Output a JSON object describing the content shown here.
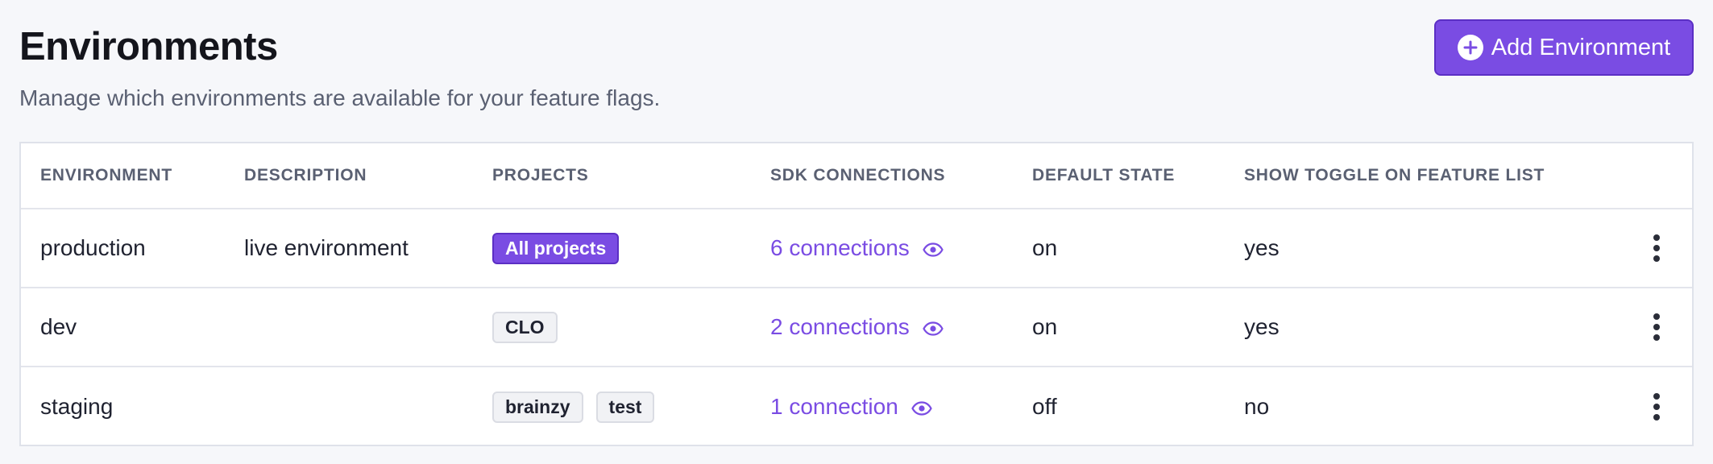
{
  "header": {
    "title": "Environments",
    "subtitle": "Manage which environments are available for your feature flags.",
    "add_button_label": "Add Environment",
    "add_button_icon": "plus-circle-icon"
  },
  "colors": {
    "accent": "#7a4ce3",
    "accent_border": "#5b2fc4",
    "text": "#1f2230",
    "muted": "#5a6072",
    "background": "#f6f7fa"
  },
  "table": {
    "columns": [
      "ENVIRONMENT",
      "DESCRIPTION",
      "PROJECTS",
      "SDK CONNECTIONS",
      "DEFAULT STATE",
      "SHOW TOGGLE ON FEATURE LIST"
    ],
    "rows": [
      {
        "environment": "production",
        "description": "live environment",
        "projects": [
          "All projects"
        ],
        "sdk_connections": "6 connections",
        "default_state": "on",
        "show_toggle": "yes"
      },
      {
        "environment": "dev",
        "description": "",
        "projects": [
          "CLO"
        ],
        "sdk_connections": "2 connections",
        "default_state": "on",
        "show_toggle": "yes"
      },
      {
        "environment": "staging",
        "description": "",
        "projects": [
          "brainzy",
          "test"
        ],
        "sdk_connections": "1 connection",
        "default_state": "off",
        "show_toggle": "no"
      }
    ],
    "row_icons": {
      "view_connections": "eye-icon",
      "row_menu": "more-vertical-icon"
    }
  }
}
